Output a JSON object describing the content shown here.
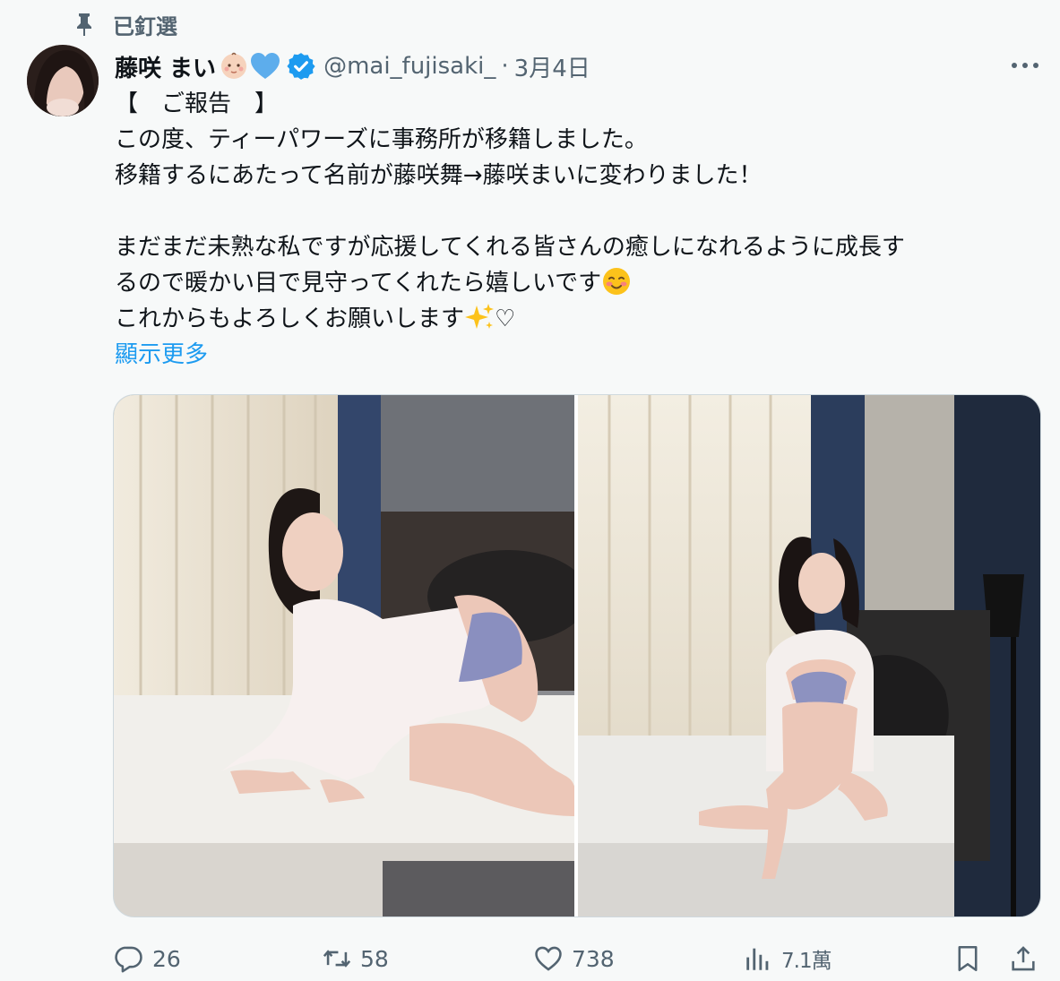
{
  "pinned": {
    "label": "已釘選",
    "icon": "pin-icon"
  },
  "author": {
    "display_name": "藤咲 まい",
    "name_emojis": [
      "baby-emoji",
      "blue-heart-emoji"
    ],
    "verified": true,
    "handle": "@mai_fujisaki_",
    "separator": "·",
    "date": "3月4日"
  },
  "tweet": {
    "lines": [
      "【　ご報告　】",
      "この度、ティーパワーズに事務所が移籍しました。",
      "移籍するにあたって名前が藤咲舞→藤咲まいに変わりました！",
      "",
      "まだまだ未熟な私ですが応援してくれる皆さんの癒しになれるように成長す",
      "るので暖かい目で見守ってくれたら嬉しいです",
      "これからもよろしくお願いします",
      "♡"
    ],
    "show_more": "顯示更多"
  },
  "media": {
    "count": 2,
    "items": [
      {
        "type": "photo",
        "scene": "bedroom-left"
      },
      {
        "type": "photo",
        "scene": "bedroom-right"
      }
    ]
  },
  "actions": {
    "reply_count": "26",
    "retweet_count": "58",
    "like_count": "738",
    "view_count": "7.1萬"
  },
  "colors": {
    "accent": "#1d9bf0",
    "text": "#0f1419",
    "muted": "#536471",
    "background": "#f7f9f9"
  }
}
